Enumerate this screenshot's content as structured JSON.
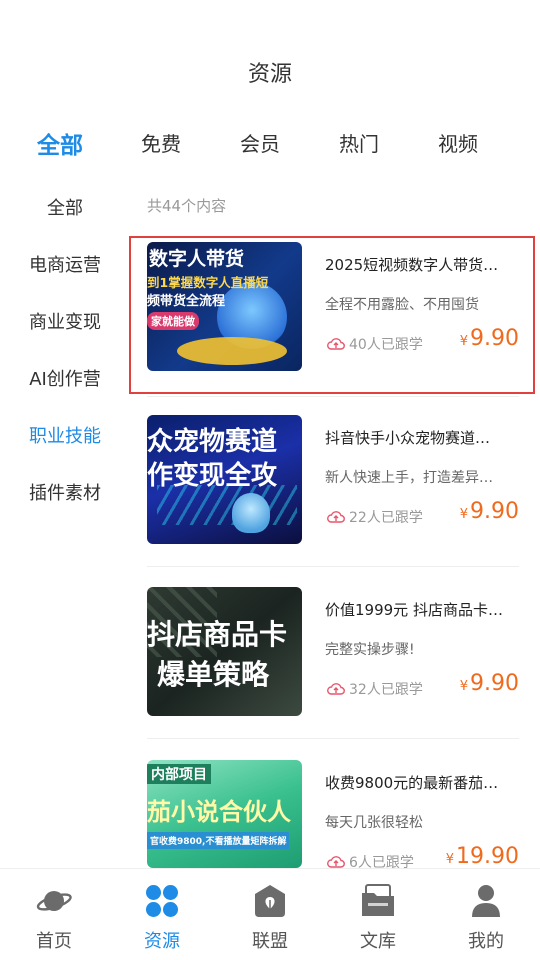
{
  "header": {
    "title": "资源"
  },
  "tabs": [
    {
      "label": "全部",
      "active": true
    },
    {
      "label": "免费"
    },
    {
      "label": "会员"
    },
    {
      "label": "热门"
    },
    {
      "label": "视频"
    }
  ],
  "sidebar": {
    "items": [
      {
        "label": "全部"
      },
      {
        "label": "电商运营"
      },
      {
        "label": "商业变现"
      },
      {
        "label": "AI创作营"
      },
      {
        "label": "职业技能",
        "active": true
      },
      {
        "label": "插件素材"
      }
    ]
  },
  "content": {
    "count_text": "共44个内容",
    "items": [
      {
        "title": "2025短视频数字人带货…",
        "subtitle": "全程不用露脸、不用囤货",
        "learners": "40人已跟学",
        "currency": "¥",
        "price": "9.90",
        "thumb_lines": [
          "数字人带货",
          "到1掌握数字人直播短",
          "频带货全流程",
          "家就能做"
        ]
      },
      {
        "title": "抖音快手小众宠物赛道…",
        "subtitle": "新人快速上手，打造差异…",
        "learners": "22人已跟学",
        "currency": "¥",
        "price": "9.90",
        "thumb_lines": [
          "众宠物赛道",
          "作变现全攻"
        ]
      },
      {
        "title": "价值1999元 抖店商品卡…",
        "subtitle": "完整实操步骤!",
        "learners": "32人已跟学",
        "currency": "¥",
        "price": "9.90",
        "thumb_lines": [
          "抖店商品卡",
          "爆单策略"
        ]
      },
      {
        "title": "收费9800元的最新番茄…",
        "subtitle": "每天几张很轻松",
        "learners": "6人已跟学",
        "currency": "¥",
        "price": "19.90",
        "thumb_lines": [
          "内部项目",
          "茄小说合伙人",
          "官收费9800,不看播放量矩阵拆解"
        ]
      }
    ]
  },
  "tabbar": [
    {
      "label": "首页",
      "icon": "planet-icon"
    },
    {
      "label": "资源",
      "icon": "grid-icon",
      "active": true
    },
    {
      "label": "联盟",
      "icon": "leaf-house-icon"
    },
    {
      "label": "文库",
      "icon": "folder-icon"
    },
    {
      "label": "我的",
      "icon": "person-icon"
    }
  ],
  "colors": {
    "accent": "#1E8BE6",
    "price": "#F06A1D",
    "highlight": "#E0413F"
  }
}
